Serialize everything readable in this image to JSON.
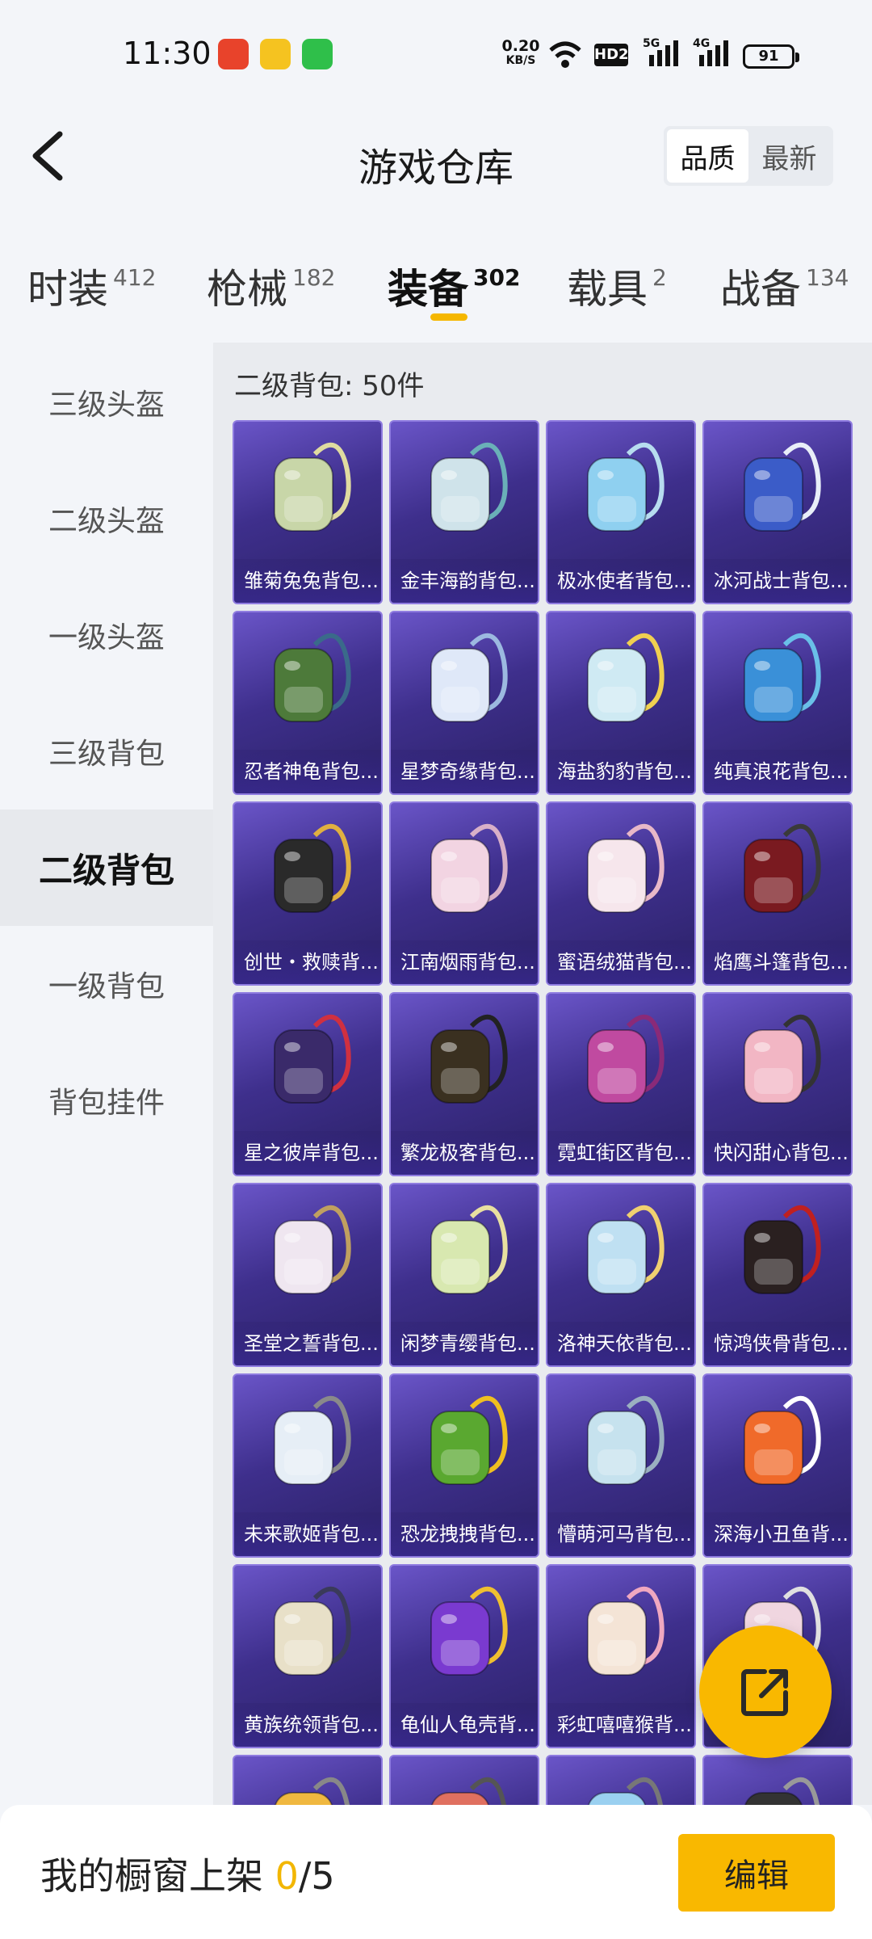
{
  "status": {
    "time": "11:30",
    "net_speed": "0.20",
    "net_unit": "KB/S",
    "hd": "HD2",
    "sig1": "5G",
    "sig2": "4G",
    "battery": "91"
  },
  "header": {
    "title": "游戏仓库",
    "sort_options": [
      "品质",
      "最新"
    ],
    "sort_active": "品质"
  },
  "categories": [
    {
      "label": "时装",
      "count": "412"
    },
    {
      "label": "枪械",
      "count": "182"
    },
    {
      "label": "装备",
      "count": "302"
    },
    {
      "label": "载具",
      "count": "2"
    },
    {
      "label": "战备",
      "count": "134"
    }
  ],
  "sidebar": {
    "items": [
      "三级头盔",
      "二级头盔",
      "一级头盔",
      "三级背包",
      "二级背包",
      "一级背包",
      "背包挂件"
    ],
    "active": "二级背包"
  },
  "section": {
    "title": "二级背包: 50件"
  },
  "items": [
    {
      "name": "雏菊兔兔背包...",
      "color": "#c8d6a8",
      "strap": "#e0dba0"
    },
    {
      "name": "金丰海韵背包...",
      "color": "#cfe3ea",
      "strap": "#6ab0b8"
    },
    {
      "name": "极冰使者背包...",
      "color": "#8fd0f0",
      "strap": "#b7dcef"
    },
    {
      "name": "冰河战士背包...",
      "color": "#3b5cc8",
      "strap": "#e8eef8"
    },
    {
      "name": "忍者神龟背包...",
      "color": "#4d7a3a",
      "strap": "#3a6a8a"
    },
    {
      "name": "星梦奇缘背包...",
      "color": "#dfe8f8",
      "strap": "#9cb9e0"
    },
    {
      "name": "海盐豹豹背包...",
      "color": "#cfeaf3",
      "strap": "#f0d050"
    },
    {
      "name": "纯真浪花背包...",
      "color": "#3a90d8",
      "strap": "#6ac0e8"
    },
    {
      "name": "创世・救赎背...",
      "color": "#2a2a2a",
      "strap": "#e0b040"
    },
    {
      "name": "江南烟雨背包...",
      "color": "#f2d4e2",
      "strap": "#d8b0c8"
    },
    {
      "name": "蜜语绒猫背包...",
      "color": "#f6e6ec",
      "strap": "#e8b8c8"
    },
    {
      "name": "焰鹰斗篷背包...",
      "color": "#7a1a20",
      "strap": "#3a3a3a"
    },
    {
      "name": "星之彼岸背包...",
      "color": "#3a2a6a",
      "strap": "#d03040"
    },
    {
      "name": "繁龙极客背包...",
      "color": "#3a3020",
      "strap": "#222222"
    },
    {
      "name": "霓虹街区背包...",
      "color": "#c04aa0",
      "strap": "#8a2a78"
    },
    {
      "name": "快闪甜心背包...",
      "color": "#f2b6c4",
      "strap": "#333333"
    },
    {
      "name": "圣堂之誓背包...",
      "color": "#efe6f0",
      "strap": "#c0a060"
    },
    {
      "name": "闲梦青缨背包...",
      "color": "#d8e8b0",
      "strap": "#e8e0a0"
    },
    {
      "name": "洛神天依背包...",
      "color": "#bfe0f2",
      "strap": "#f0d070"
    },
    {
      "name": "惊鸿侠骨背包...",
      "color": "#2a2020",
      "strap": "#c02020"
    },
    {
      "name": "未来歌姬背包...",
      "color": "#e6eef6",
      "strap": "#8a8a8a"
    },
    {
      "name": "恐龙拽拽背包...",
      "color": "#5aa830",
      "strap": "#f0c020"
    },
    {
      "name": "懵萌河马背包...",
      "color": "#c6e2ee",
      "strap": "#9ab0c0"
    },
    {
      "name": "深海小丑鱼背...",
      "color": "#f06a2a",
      "strap": "#ffffff"
    },
    {
      "name": "黄族统领背包...",
      "color": "#e8e0c8",
      "strap": "#3a3a5a"
    },
    {
      "name": "龟仙人龟壳背...",
      "color": "#7a3ad0",
      "strap": "#f0c030"
    },
    {
      "name": "彩虹嘻嘻猴背...",
      "color": "#f4e4d6",
      "strap": "#f0a8c0"
    },
    {
      "name": "",
      "color": "#f0d6e0",
      "strap": "#e0e0e0"
    },
    {
      "name": "",
      "color": "#f0b840",
      "strap": "#888888"
    },
    {
      "name": "",
      "color": "#e07060",
      "strap": "#555555"
    },
    {
      "name": "",
      "color": "#9ad0f0",
      "strap": "#777777"
    },
    {
      "name": "",
      "color": "#333333",
      "strap": "#999999"
    }
  ],
  "bottom": {
    "shelf_label": "我的橱窗上架",
    "shelf_count": "0",
    "shelf_total": "/5",
    "edit_label": "编辑"
  }
}
